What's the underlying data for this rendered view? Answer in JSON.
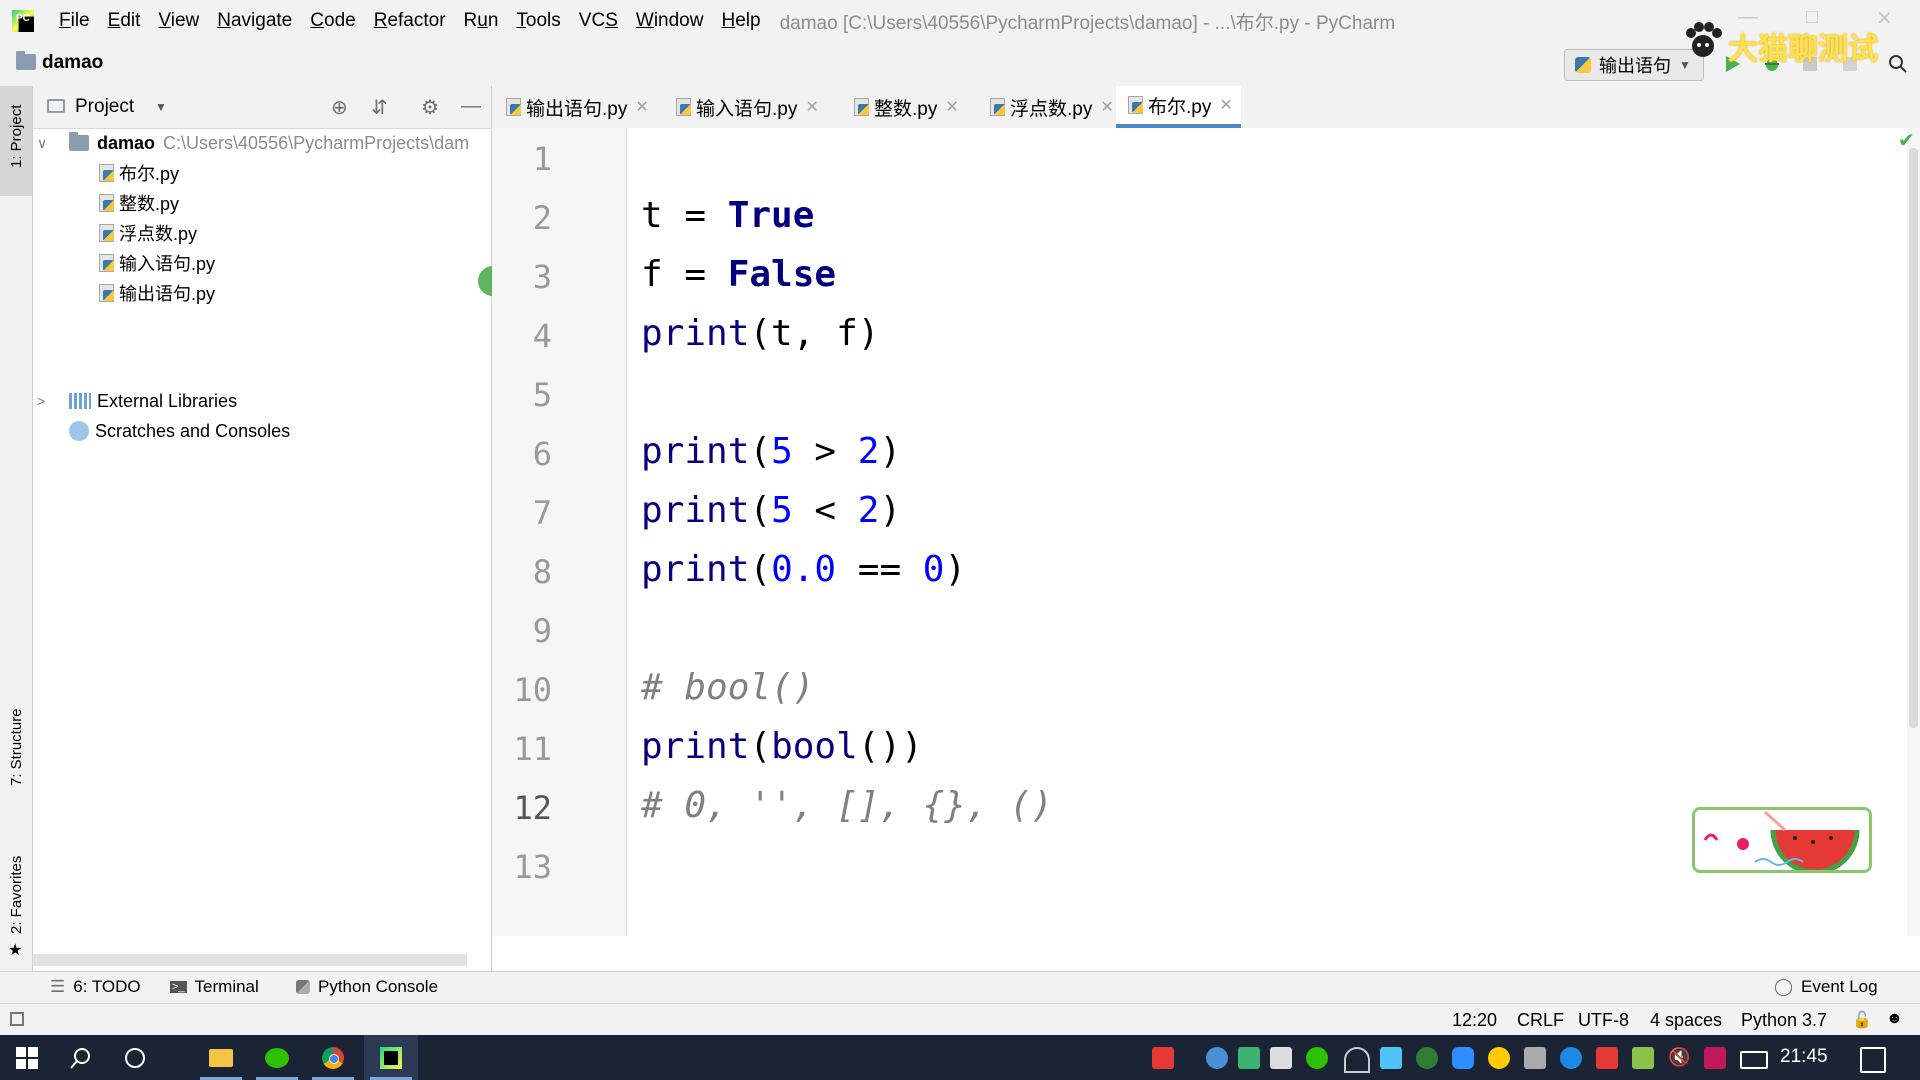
{
  "menu": {
    "items": [
      {
        "label": "File",
        "mnemonic": "F"
      },
      {
        "label": "Edit",
        "mnemonic": "E"
      },
      {
        "label": "View",
        "mnemonic": "V"
      },
      {
        "label": "Navigate",
        "mnemonic": "N"
      },
      {
        "label": "Code",
        "mnemonic": "C"
      },
      {
        "label": "Refactor",
        "mnemonic": "R"
      },
      {
        "label": "Run",
        "mnemonic": "u"
      },
      {
        "label": "Tools",
        "mnemonic": "T"
      },
      {
        "label": "VCS",
        "mnemonic": "S"
      },
      {
        "label": "Window",
        "mnemonic": "W"
      },
      {
        "label": "Help",
        "mnemonic": "H"
      }
    ],
    "window_title": "damao [C:\\Users\\40556\\PycharmProjects\\damao] - ...\\布尔.py - PyCharm"
  },
  "navbar": {
    "project_label": "damao",
    "run_config": "输出语句"
  },
  "watermark": {
    "text": "大猫聊测试"
  },
  "left_strip": {
    "project_tab": "1: Project",
    "structure_tab": "7: Structure",
    "favorites_tab": "2: Favorites"
  },
  "project_panel": {
    "title": "Project",
    "root": {
      "name": "damao",
      "path": "C:\\Users\\40556\\PycharmProjects\\dam"
    },
    "files": [
      "布尔.py",
      "整数.py",
      "浮点数.py",
      "输入语句.py",
      "输出语句.py"
    ],
    "external_libraries": "External Libraries",
    "scratches": "Scratches and Consoles"
  },
  "editor": {
    "tabs": [
      {
        "label": "输出语句.py",
        "active": false
      },
      {
        "label": "输入语句.py",
        "active": false
      },
      {
        "label": "整数.py",
        "active": false
      },
      {
        "label": "浮点数.py",
        "active": false
      },
      {
        "label": "布尔.py",
        "active": true
      }
    ],
    "line_numbers": [
      "1",
      "2",
      "3",
      "4",
      "5",
      "6",
      "7",
      "8",
      "9",
      "10",
      "11",
      "12",
      "13"
    ],
    "current_line": 12,
    "lines": [
      [],
      [
        {
          "t": "t = ",
          "c": "plain"
        },
        {
          "t": "True",
          "c": "kw"
        }
      ],
      [
        {
          "t": "f = ",
          "c": "plain"
        },
        {
          "t": "False",
          "c": "kw"
        }
      ],
      [
        {
          "t": "print",
          "c": "fn"
        },
        {
          "t": "(t, f)",
          "c": "plain"
        }
      ],
      [],
      [
        {
          "t": "print",
          "c": "fn"
        },
        {
          "t": "(",
          "c": "plain"
        },
        {
          "t": "5",
          "c": "num"
        },
        {
          "t": " > ",
          "c": "plain"
        },
        {
          "t": "2",
          "c": "num"
        },
        {
          "t": ")",
          "c": "plain"
        }
      ],
      [
        {
          "t": "print",
          "c": "fn"
        },
        {
          "t": "(",
          "c": "plain"
        },
        {
          "t": "5",
          "c": "num"
        },
        {
          "t": " < ",
          "c": "plain"
        },
        {
          "t": "2",
          "c": "num"
        },
        {
          "t": ")",
          "c": "plain"
        }
      ],
      [
        {
          "t": "print",
          "c": "fn"
        },
        {
          "t": "(",
          "c": "plain"
        },
        {
          "t": "0.0",
          "c": "num"
        },
        {
          "t": " == ",
          "c": "plain"
        },
        {
          "t": "0",
          "c": "num"
        },
        {
          "t": ")",
          "c": "plain"
        }
      ],
      [],
      [
        {
          "t": "# bool()",
          "c": "cm"
        }
      ],
      [
        {
          "t": "print",
          "c": "fn"
        },
        {
          "t": "(",
          "c": "plain"
        },
        {
          "t": "bool",
          "c": "fn"
        },
        {
          "t": "())",
          "c": "plain"
        }
      ],
      [
        {
          "t": "# 0, '', [], {}, ()",
          "c": "cm"
        }
      ],
      []
    ]
  },
  "bottom_tools": {
    "todo": "6: TODO",
    "terminal": "Terminal",
    "python_console": "Python Console",
    "event_log": "Event Log"
  },
  "status": {
    "position": "12:20",
    "line_sep": "CRLF",
    "encoding": "UTF-8",
    "indent": "4 spaces",
    "interpreter": "Python 3.7"
  },
  "taskbar": {
    "time": "21:45"
  },
  "colors": {
    "keyword": "#000080",
    "number": "#0000ff",
    "comment": "#808080",
    "current_line_bg": "#fffae3",
    "active_tab_underline": "#4a88c7"
  }
}
